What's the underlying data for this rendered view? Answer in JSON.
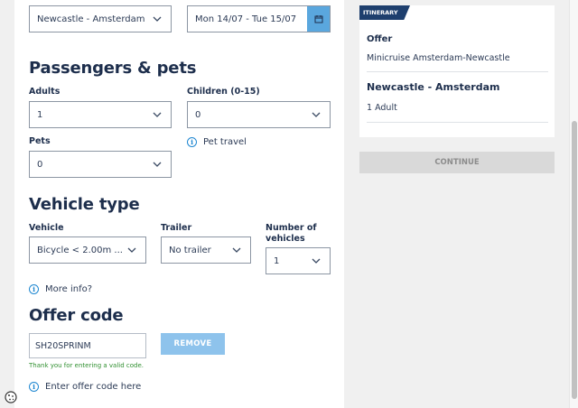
{
  "route": {
    "selected": "Newcastle - Amsterdam"
  },
  "dates": {
    "value": "Mon 14/07 - Tue 15/07"
  },
  "passengers": {
    "heading": "Passengers & pets",
    "adults_label": "Adults",
    "adults_value": "1",
    "children_label": "Children (0-15)",
    "children_value": "0",
    "pets_label": "Pets",
    "pets_value": "0",
    "pet_travel_link": "Pet travel"
  },
  "vehicle": {
    "heading": "Vehicle type",
    "vehicle_label": "Vehicle",
    "vehicle_value": "Bicycle < 2.00m ...",
    "trailer_label": "Trailer",
    "trailer_value": "No trailer",
    "number_label_line1": "Number of",
    "number_label_line2": "vehicles",
    "number_value": "1",
    "more_info": "More info?"
  },
  "offer": {
    "heading": "Offer code",
    "code_value": "SH20SPRINM",
    "remove_label": "REMOVE",
    "valid_message": "Thank you for entering a valid code.",
    "enter_link": "Enter offer code here"
  },
  "itinerary": {
    "tab_label": "ITINERARY",
    "offer_heading": "Offer",
    "offer_text": "Minicruise Amsterdam-Newcastle",
    "route_heading": "Newcastle - Amsterdam",
    "passengers_text": "1 Adult"
  },
  "continue_label": "CONTINUE",
  "icons": {
    "chevron": "chevron-down-icon",
    "calendar": "calendar-icon",
    "info": "info-icon",
    "cookie": "cookie-icon"
  },
  "colors": {
    "navy": "#1d2e4c",
    "accent_blue": "#5aa7de",
    "info_blue": "#1f87d1",
    "remove_button": "#8ec3ec",
    "valid_green": "#2f8f2f",
    "itinerary_tab": "#1e3f6e",
    "continue_disabled": "#d9d9d9"
  }
}
